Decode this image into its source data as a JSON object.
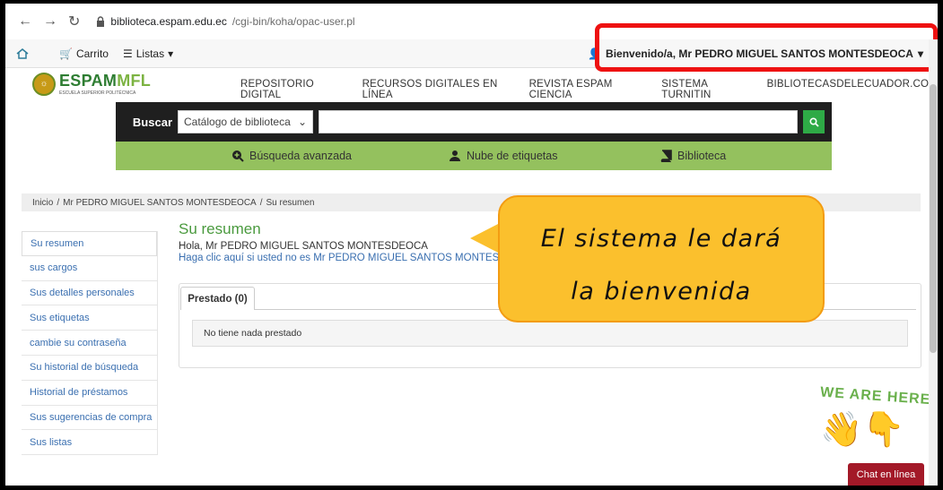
{
  "browser": {
    "url_domain": "biblioteca.espam.edu.ec",
    "url_path": "/cgi-bin/koha/opac-user.pl"
  },
  "topbar": {
    "cart": "Carrito",
    "lists": "Listas",
    "welcome": "Bienvenido/a, Mr PEDRO MIGUEL SANTOS MONTESDEOCA"
  },
  "logo": {
    "brand_a": "ESPAM",
    "brand_b": "MFL",
    "sub": "ESCUELA SUPERIOR POLITÉCNICA"
  },
  "nav_links": [
    "REPOSITORIO DIGITAL",
    "RECURSOS DIGITALES EN LÍNEA",
    "REVISTA ESPAM CIENCIA",
    "SISTEMA TURNITIN",
    "BIBLIOTECASDELECUADOR.COM"
  ],
  "search": {
    "label": "Buscar",
    "scope": "Catálogo de biblioteca",
    "query": ""
  },
  "green_links": {
    "advanced": "Búsqueda avanzada",
    "tags": "Nube de etiquetas",
    "library": "Biblioteca"
  },
  "breadcrumb": {
    "home": "Inicio",
    "user": "Mr PEDRO MIGUEL SANTOS MONTESDEOCA",
    "current": "Su resumen"
  },
  "sidebar": [
    "Su resumen",
    "sus cargos",
    "Sus detalles personales",
    "Sus etiquetas",
    "cambie su contraseña",
    "Su historial de búsqueda",
    "Historial de préstamos",
    "Sus sugerencias de compra",
    "Sus listas"
  ],
  "main": {
    "title": "Su resumen",
    "greeting": "Hola, Mr PEDRO MIGUEL SANTOS MONTESDEOCA",
    "not_you": "Haga clic aquí si usted no es Mr PEDRO MIGUEL SANTOS MONTESDEO",
    "tab": "Prestado (0)",
    "empty": "No tiene nada prestado"
  },
  "callout": {
    "line1": "El sistema le dará",
    "line2": "la bienvenida"
  },
  "chat": {
    "badge": "WE ARE HERE!",
    "button": "Chat en línea"
  },
  "colors": {
    "green_bar": "#94c15e",
    "search_bar": "#1f1f1f",
    "callout": "#fbc02d",
    "highlight": "#ee1111",
    "chat": "#a31928"
  }
}
